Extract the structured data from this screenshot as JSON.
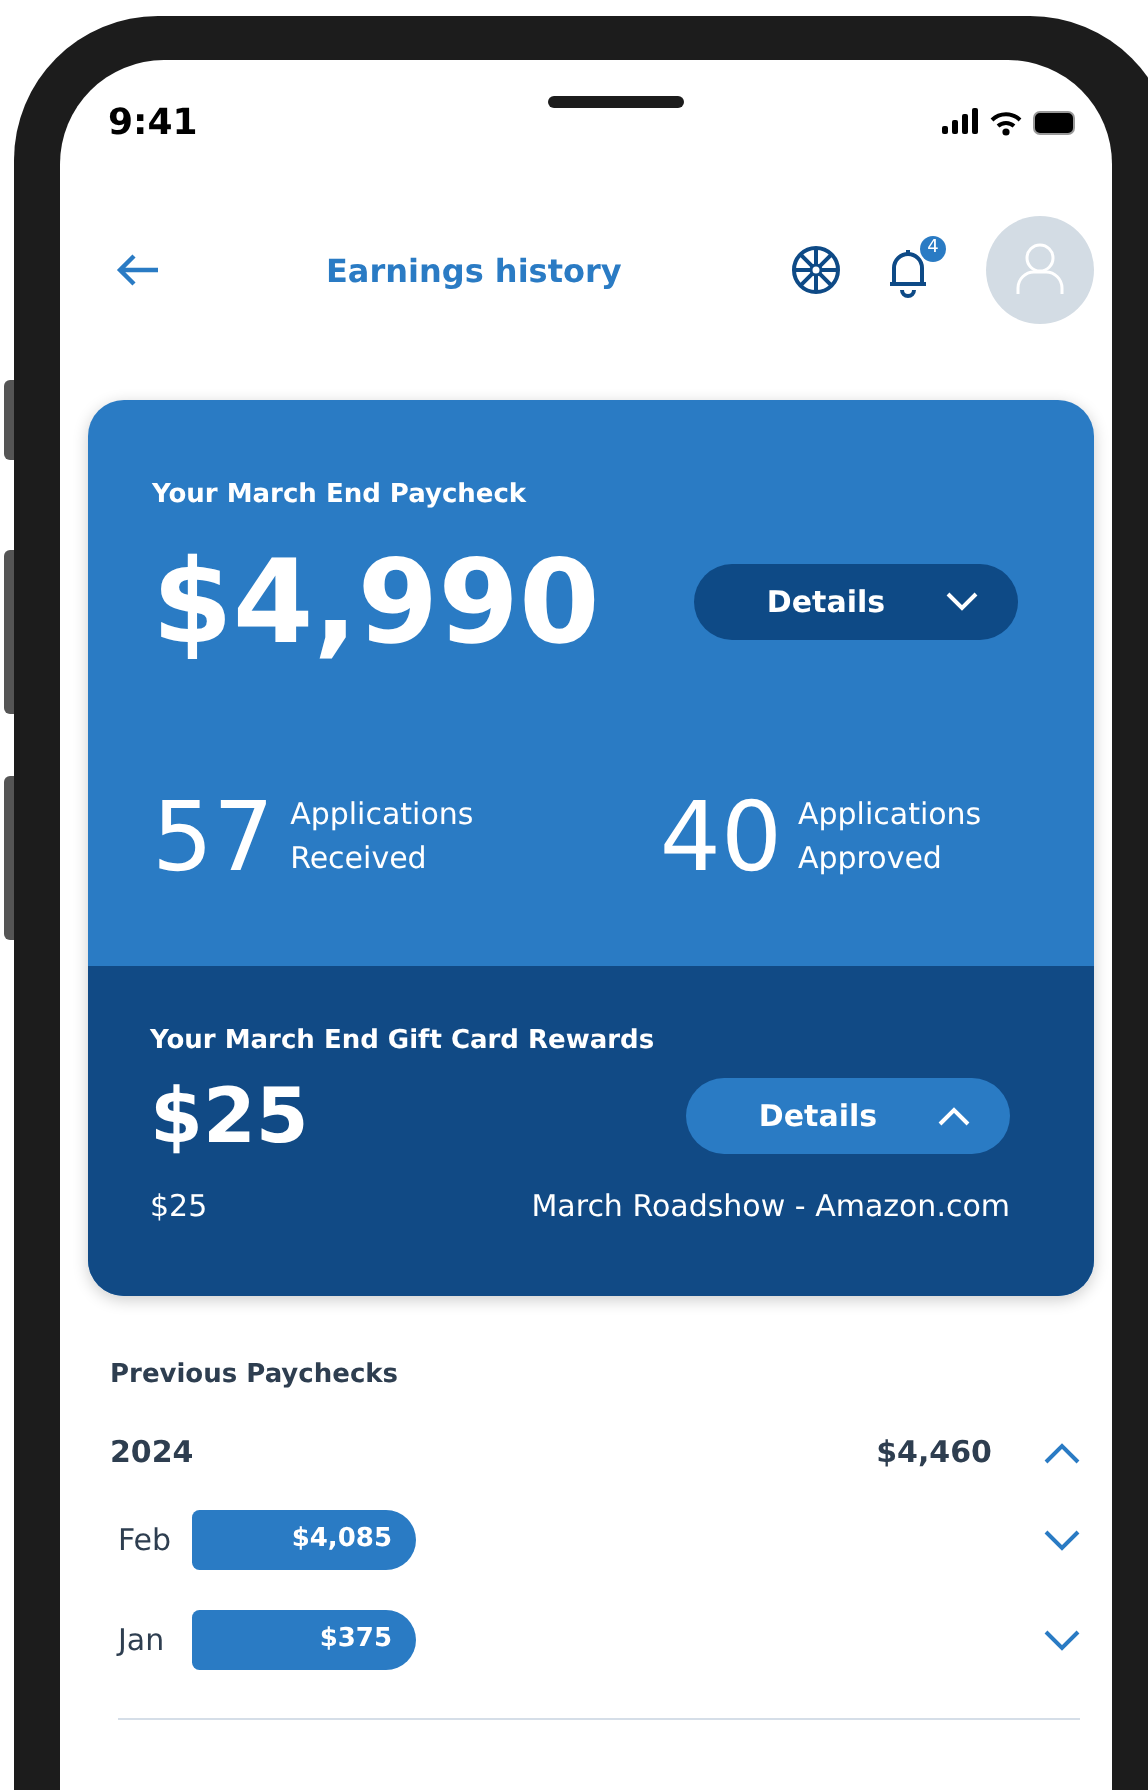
{
  "status_bar": {
    "time": "9:41"
  },
  "header": {
    "title": "Earnings history",
    "notification_count": "4"
  },
  "paycheck": {
    "title": "Your March End Paycheck",
    "amount": "$4,990",
    "details_button": {
      "label": "Details",
      "expanded": false
    },
    "stats": [
      {
        "value": "57",
        "label": "Applications Received"
      },
      {
        "value": "40",
        "label": "Applications Approved"
      }
    ]
  },
  "gift_card": {
    "title": "Your March End Gift Card Rewards",
    "amount": "$25",
    "details_button": {
      "label": "Details",
      "expanded": true
    },
    "items": [
      {
        "amount": "$25",
        "description": "March Roadshow - Amazon.com"
      }
    ]
  },
  "previous": {
    "title": "Previous Paychecks",
    "years": [
      {
        "year": "2024",
        "total": "$4,460",
        "expanded": true,
        "months": [
          {
            "month": "Feb",
            "amount": "$4,085",
            "expanded": false
          },
          {
            "month": "Jan",
            "amount": "$375",
            "expanded": false
          }
        ]
      }
    ]
  }
}
